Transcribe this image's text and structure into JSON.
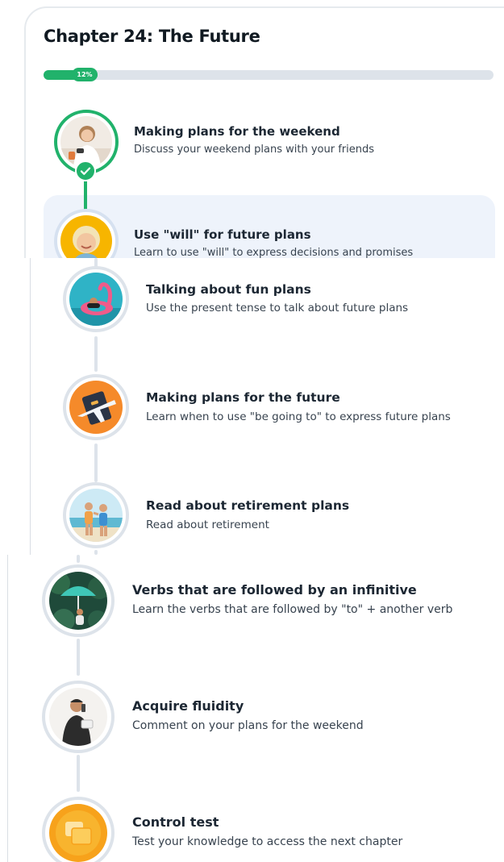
{
  "chapter": {
    "title": "Chapter 24: The Future",
    "progress_percent": 12,
    "progress_label": "12%"
  },
  "colors": {
    "accent_green": "#21b26b",
    "track_gray": "#dde3ea",
    "current_lesson_bg": "#eef3fb"
  },
  "lessons": [
    {
      "title": "Making plans for the weekend",
      "description": "Discuss your weekend plans with your friends",
      "status": "completed",
      "icon": "woman-on-phone-thumbnail"
    },
    {
      "title": "Use \"will\" for future plans",
      "description": "Learn to use \"will\" to express decisions and promises",
      "status": "current",
      "icon": "smiling-woman-thumbnail"
    },
    {
      "title": "Talking about fun plans",
      "description": "Use the present tense to talk about future plans",
      "status": "locked",
      "icon": "flamingo-float-thumbnail"
    },
    {
      "title": "Making plans for the future",
      "description": "Learn when to use \"be going to\" to express future plans",
      "status": "locked",
      "icon": "airplane-passport-thumbnail"
    },
    {
      "title": "Read about retirement plans",
      "description": "Read about retirement",
      "status": "locked",
      "icon": "beach-couple-thumbnail"
    },
    {
      "title": "Verbs that are followed by an infinitive",
      "description": "Learn the verbs that are followed by \"to\" + another verb",
      "status": "locked",
      "icon": "umbrella-jungle-thumbnail"
    },
    {
      "title": "Acquire fluidity",
      "description": "Comment on your plans for the weekend",
      "status": "locked",
      "icon": "man-on-phone-thumbnail"
    },
    {
      "title": "Control test",
      "description": "Test your knowledge to access the next chapter",
      "status": "locked",
      "icon": "test-badge-icon"
    }
  ]
}
